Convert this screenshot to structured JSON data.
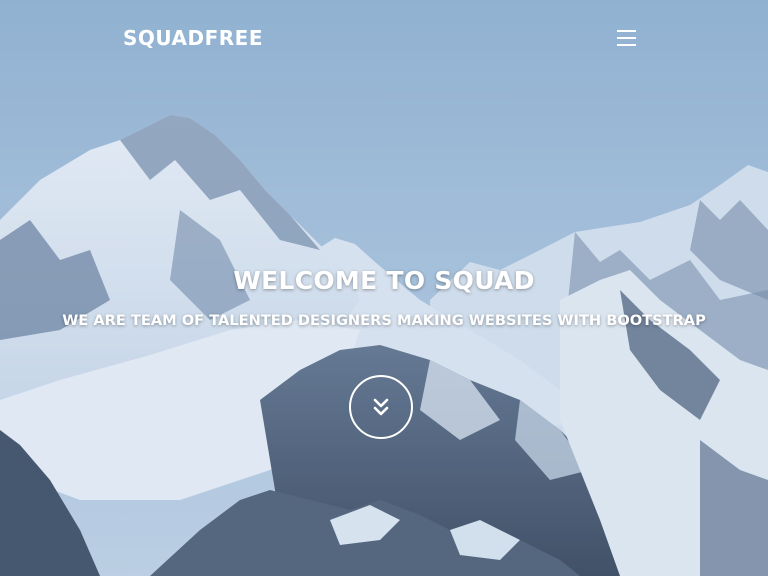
{
  "navbar": {
    "brand": "SQUADFREE",
    "menu_icon": "hamburger-menu-icon"
  },
  "hero": {
    "title": "WELCOME TO SQUAD",
    "subtitle": "WE ARE TEAM OF TALENTED DESIGNERS MAKING WEBSITES WITH BOOTSTRAP",
    "scroll_icon": "double-chevron-down-icon",
    "background": "snowy-mountain-range-photo"
  },
  "colors": {
    "text": "#ffffff",
    "sky": "#9fbcd8",
    "snow": "#e6eef6",
    "rock": "#3c4c62"
  }
}
